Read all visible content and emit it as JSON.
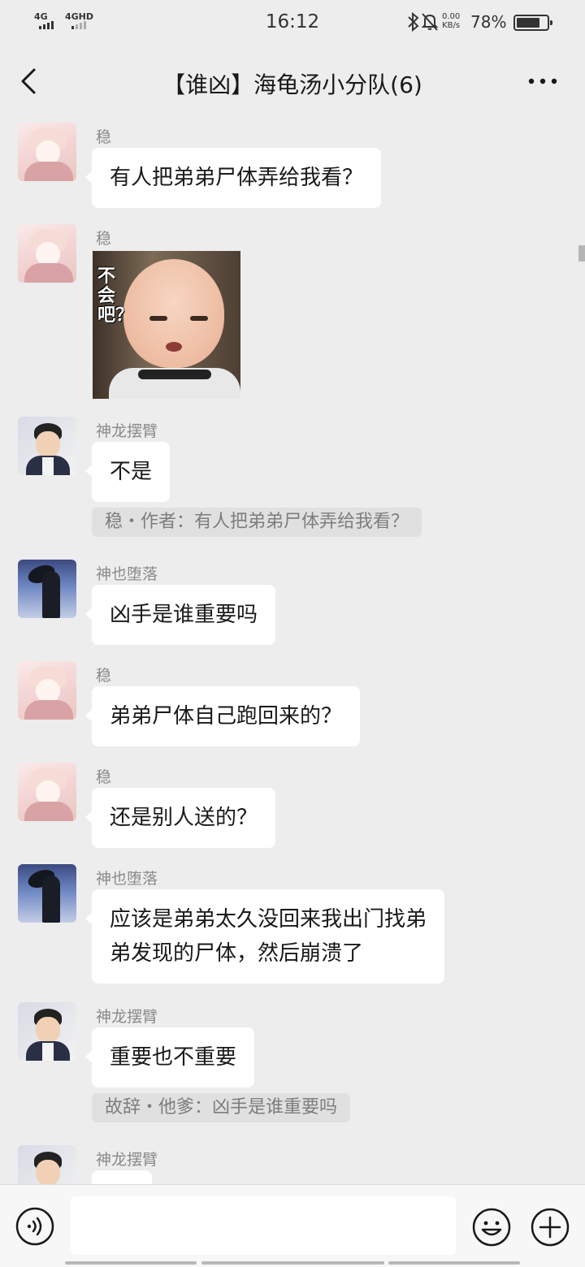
{
  "status_bar": {
    "sim1": "4G",
    "sim2": "4GHD",
    "time": "16:12",
    "net_speed_value": "0.00",
    "net_speed_unit": "KB/s",
    "battery_percent": "78%",
    "battery_level": 0.78,
    "icons": [
      "bluetooth-icon",
      "mute-icon"
    ]
  },
  "nav": {
    "title": "【谁凶】海龟汤小分队(6)",
    "back_icon": "chevron-left-icon",
    "more_icon": "more-dots-icon"
  },
  "messages": [
    {
      "sender": "稳",
      "avatar": "avatar-wen",
      "text": "有人把弟弟尸体弄给我看？"
    },
    {
      "sender": "稳",
      "avatar": "avatar-wen",
      "sticker_caption": "不会吧？"
    },
    {
      "sender": "神龙摆臂",
      "avatar": "avatar-shenlong",
      "text": "不是",
      "quote": "稳・作者：有人把弟弟尸体弄给我看？"
    },
    {
      "sender": "神也堕落",
      "avatar": "avatar-shenye",
      "text": "凶手是谁重要吗"
    },
    {
      "sender": "稳",
      "avatar": "avatar-wen",
      "text": "弟弟尸体自己跑回来的？"
    },
    {
      "sender": "稳",
      "avatar": "avatar-wen",
      "text": "还是别人送的？"
    },
    {
      "sender": "神也堕落",
      "avatar": "avatar-shenye",
      "text_lines": [
        "应该是弟弟太久没回来我出门找弟",
        "弟发现的尸体，然后崩溃了"
      ]
    },
    {
      "sender": "神龙摆臂",
      "avatar": "avatar-shenlong",
      "text": "重要也不重要",
      "quote": "故辞・他爹：凶手是谁重要吗"
    },
    {
      "sender": "神龙摆臂",
      "avatar": "avatar-shenlong",
      "text": ""
    }
  ],
  "input_bar": {
    "value": "",
    "voice_icon": "voice-icon",
    "emoji_icon": "emoji-icon",
    "plus_icon": "plus-icon"
  },
  "colors": {
    "background": "#ededed",
    "bubble": "#ffffff",
    "quote_bg": "#e0e0e0",
    "sender_text": "#8a8a8a"
  }
}
